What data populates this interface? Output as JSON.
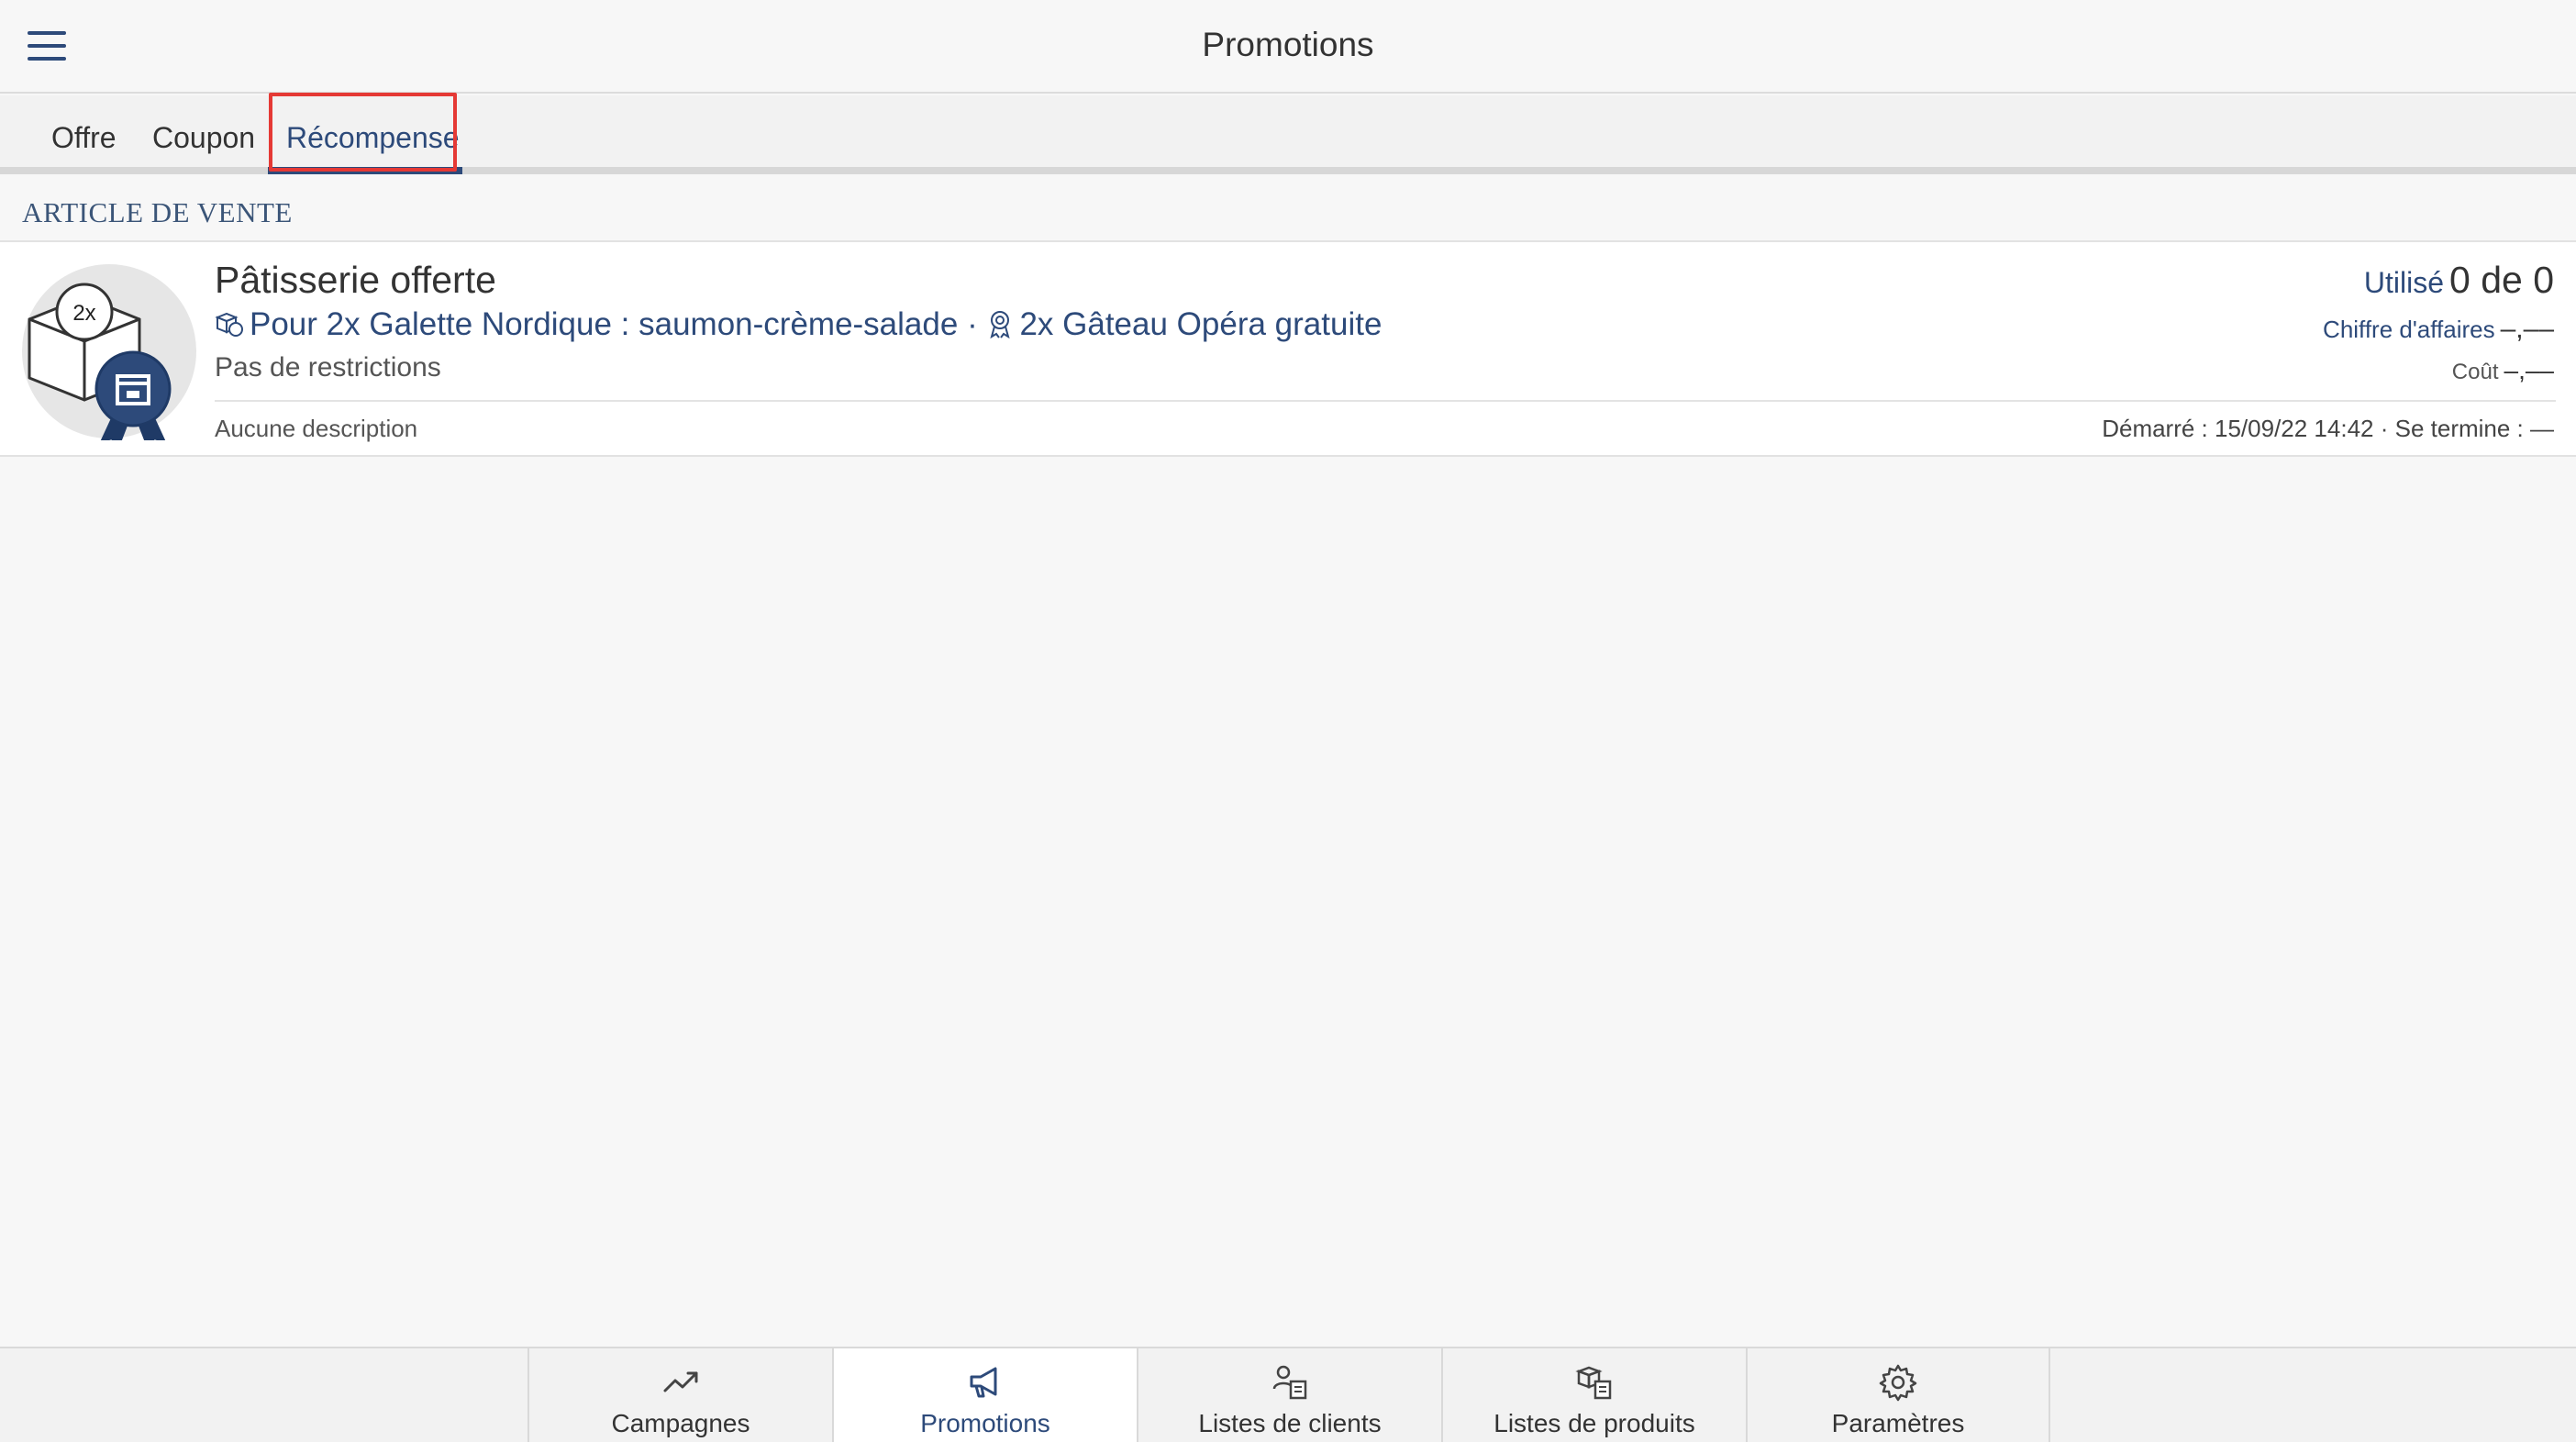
{
  "header": {
    "title": "Promotions",
    "menu_icon": "hamburger-menu-icon"
  },
  "tabs": [
    {
      "label": "Offre",
      "active": false
    },
    {
      "label": "Coupon",
      "active": false
    },
    {
      "label": "Récompense",
      "active": true
    }
  ],
  "section": {
    "title": "ARTICLE DE VENTE"
  },
  "item": {
    "title": "Pâtisserie offerte",
    "badge_text": "2x",
    "condition_icon": "products-icon",
    "condition_text": "Pour 2x Galette Nordique : saumon-crème-salade",
    "separator": "·",
    "reward_icon": "reward-ribbon-icon",
    "reward_text": "2x Gâteau Opéra gratuite",
    "restrictions": "Pas de restrictions",
    "description": "Aucune description",
    "used_label": "Utilisé",
    "used_value": "0 de 0",
    "revenue_label": "Chiffre d'affaires",
    "revenue_value": "–,––",
    "cost_label": "Coût",
    "cost_value": "–,––",
    "dates": "Démarré : 15/09/22 14:42 · Se termine : —"
  },
  "bottom_nav": [
    {
      "label": "Campagnes",
      "icon": "trend-up-icon",
      "active": false
    },
    {
      "label": "Promotions",
      "icon": "megaphone-icon",
      "active": true
    },
    {
      "label": "Listes de clients",
      "icon": "customer-list-icon",
      "active": false
    },
    {
      "label": "Listes de produits",
      "icon": "product-list-icon",
      "active": false
    },
    {
      "label": "Paramètres",
      "icon": "gear-icon",
      "active": false
    }
  ],
  "colors": {
    "accent": "#2d4a7a",
    "highlight": "#e53935",
    "background": "#f7f7f7"
  }
}
